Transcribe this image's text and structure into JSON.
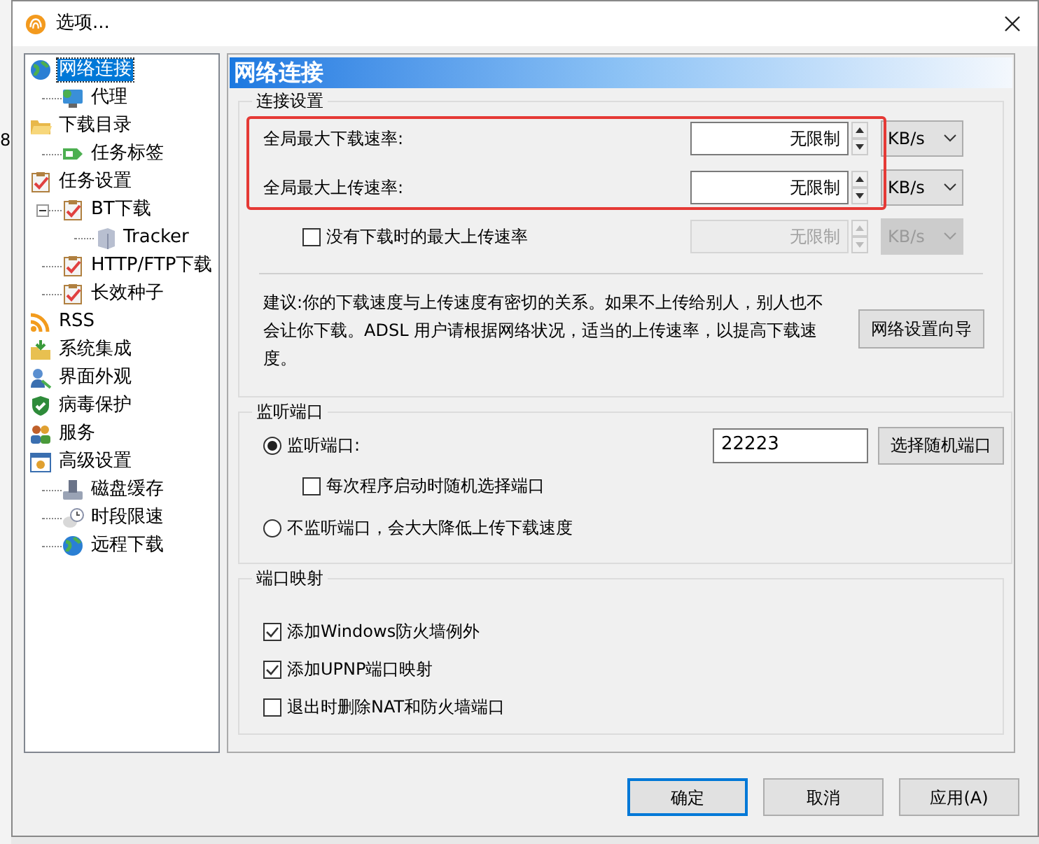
{
  "background": {
    "cell": "8"
  },
  "window": {
    "title": "选项..."
  },
  "tree": [
    {
      "label": "网络连接",
      "selected": true,
      "children": [
        {
          "label": "代理",
          "selected": false
        }
      ]
    },
    {
      "label": "下载目录",
      "selected": false,
      "children": [
        {
          "label": "任务标签",
          "selected": false
        }
      ]
    },
    {
      "label": "任务设置",
      "selected": false,
      "children": [
        {
          "label": "BT下载",
          "selected": false,
          "expanded": true,
          "children": [
            {
              "label": "Tracker",
              "selected": false
            }
          ]
        },
        {
          "label": "HTTP/FTP下载",
          "selected": false
        },
        {
          "label": "长效种子",
          "selected": false
        }
      ]
    },
    {
      "label": "RSS",
      "selected": false
    },
    {
      "label": "系统集成",
      "selected": false
    },
    {
      "label": "界面外观",
      "selected": false
    },
    {
      "label": "病毒保护",
      "selected": false
    },
    {
      "label": "服务",
      "selected": false
    },
    {
      "label": "高级设置",
      "selected": false,
      "children": [
        {
          "label": "磁盘缓存",
          "selected": false
        },
        {
          "label": "时段限速",
          "selected": false
        },
        {
          "label": "远程下载",
          "selected": false
        }
      ]
    }
  ],
  "panel": {
    "title": "网络连接",
    "connection": {
      "title": "连接设置",
      "rates": [
        {
          "kind": "rate",
          "label": "全局最大下载速率:",
          "value": "无限制",
          "unit": "KB/s",
          "disabled": false,
          "highlighted": true
        },
        {
          "kind": "rate",
          "label": "全局最大上传速率:",
          "value": "无限制",
          "unit": "KB/s",
          "disabled": false,
          "highlighted": true
        },
        {
          "kind": "checkbox_rate",
          "label": "没有下载时的最大上传速率",
          "checked": false,
          "value": "无限制",
          "unit": "KB/s",
          "disabled": true,
          "highlighted": false
        }
      ],
      "advice": "建议:你的下载速度与上传速度有密切的关系。如果不上传给别人，别人也不会让你下载。ADSL 用户请根据网络状况，适当的上传速率，以提高下载速度。",
      "wizard_button": "网络设置向导"
    },
    "listen": {
      "title": "监听端口",
      "options": [
        {
          "kind": "radio_port",
          "label": "监听端口:",
          "selected": true,
          "port": "22223",
          "button": "选择随机端口"
        },
        {
          "kind": "checkbox",
          "label": "每次程序启动时随机选择端口",
          "checked": false
        },
        {
          "kind": "radio",
          "label": "不监听端口，会大大降低上传下载速度",
          "selected": false
        }
      ]
    },
    "mapping": {
      "title": "端口映射",
      "options": [
        {
          "label": "添加Windows防火墙例外",
          "checked": true
        },
        {
          "label": "添加UPNP端口映射",
          "checked": true
        },
        {
          "label": "退出时删除NAT和防火墙端口",
          "checked": false
        }
      ]
    }
  },
  "buttons": [
    {
      "label": "确定",
      "default": true
    },
    {
      "label": "取消",
      "default": false
    },
    {
      "label": "应用(A)",
      "default": false
    }
  ]
}
